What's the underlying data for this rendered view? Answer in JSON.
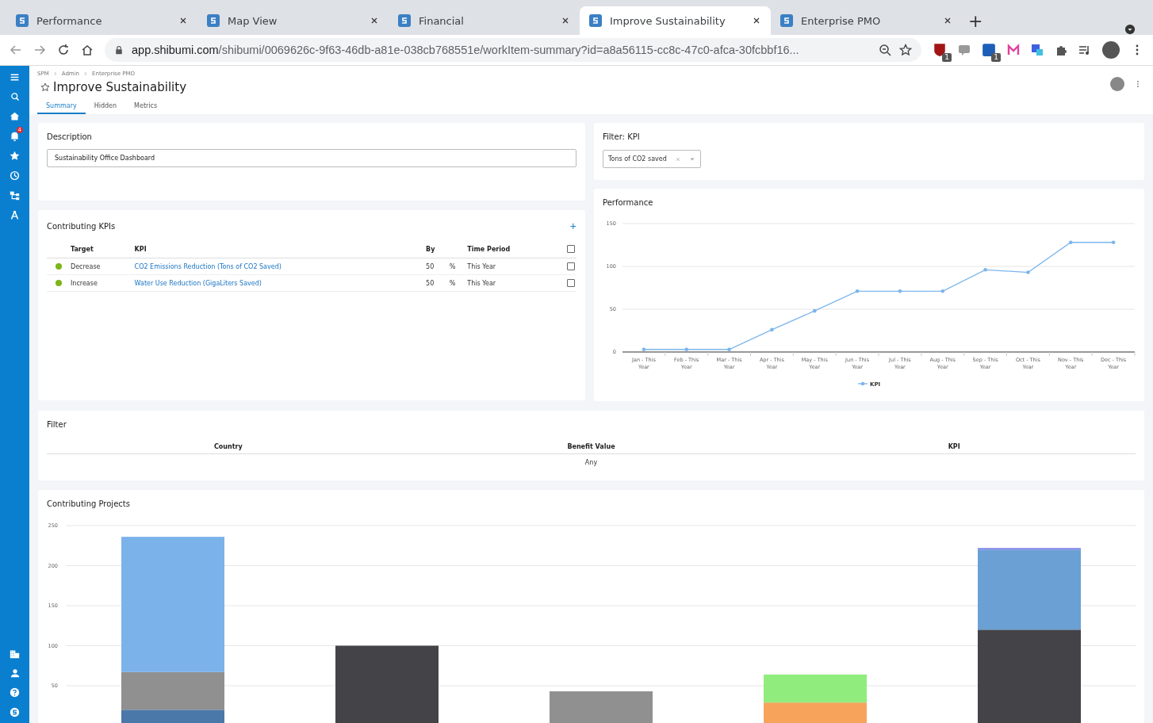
{
  "browser": {
    "tabs": [
      {
        "title": "Performance",
        "selected": false
      },
      {
        "title": "Map View",
        "selected": false
      },
      {
        "title": "Financial",
        "selected": false
      },
      {
        "title": "Improve Sustainability",
        "selected": true
      },
      {
        "title": "Enterprise PMO",
        "selected": false
      }
    ],
    "new_tab": "+",
    "url_host": "app.shibumi.com",
    "url_path": "/shibumi/0069626c-9f63-46db-a81e-038cb768551e/workItem-summary?id=a8a56115-cc8c-47c0-afca-30fcbbf16...",
    "extension_badges": [
      "1",
      "1"
    ]
  },
  "sidebar": {
    "notification_count": "4"
  },
  "header": {
    "breadcrumb": [
      "SPM",
      "Admin",
      "Enterprise PMO"
    ],
    "title": "Improve Sustainability",
    "favorite": false,
    "tabs": [
      {
        "label": "Summary",
        "selected": true
      },
      {
        "label": "Hidden",
        "selected": false
      },
      {
        "label": "Metrics",
        "selected": false
      }
    ]
  },
  "description": {
    "title": "Description",
    "value": "Sustainability Office Dashboard"
  },
  "filter_kpi": {
    "title": "Filter: KPI",
    "value": "Tons of CO2 saved"
  },
  "kpis": {
    "title": "Contributing KPIs",
    "add": "+",
    "columns": {
      "target": "Target",
      "kpi": "KPI",
      "by": "By",
      "time_period": "Time Period"
    },
    "all_checked": false,
    "rows": [
      {
        "color": "#7cb518",
        "target": "Decrease",
        "kpi": "CO2 Emissions Reduction (Tons of CO2 Saved)",
        "by": "50",
        "unit": "%",
        "time_period": "This Year",
        "checked": false
      },
      {
        "color": "#7cb518",
        "target": "Increase",
        "kpi": "Water Use Reduction (GigaLiters Saved)",
        "by": "50",
        "unit": "%",
        "time_period": "This Year",
        "checked": false
      }
    ]
  },
  "performance": {
    "title": "Performance",
    "chart_data": {
      "type": "line",
      "categories": [
        "Jan - This Year",
        "Feb - This Year",
        "Mar - This Year",
        "Apr - This Year",
        "May - This Year",
        "Jun - This Year",
        "Jul - This Year",
        "Aug - This Year",
        "Sep - This Year",
        "Oct - This Year",
        "Nov - This Year",
        "Dec - This Year"
      ],
      "series": [
        {
          "name": "KPI",
          "color": "#7cb5ec",
          "values": [
            3,
            3,
            3,
            26,
            48,
            71,
            71,
            71,
            96,
            93,
            128,
            128
          ]
        }
      ],
      "ylim": [
        0,
        150
      ],
      "yticks": [
        0,
        50,
        100,
        150
      ]
    }
  },
  "filter": {
    "title": "Filter",
    "columns": [
      {
        "label": "Country"
      },
      {
        "label": "Benefit Value",
        "value": "Any"
      },
      {
        "label": "KPI"
      }
    ]
  },
  "projects": {
    "title": "Contributing Projects",
    "chart_data": {
      "type": "bar",
      "stacked": true,
      "series": [
        {
          "color": "#4a78a8",
          "values": [
            20,
            0,
            0,
            0,
            0
          ]
        },
        {
          "color": "#909090",
          "values": [
            47,
            0,
            43,
            0,
            0
          ]
        },
        {
          "color": "#7cb2ea",
          "values": [
            169,
            0,
            0,
            0,
            0
          ]
        },
        {
          "color": "#434348",
          "values": [
            0,
            100,
            0,
            0,
            120
          ]
        },
        {
          "color": "#f7a35c",
          "values": [
            0,
            0,
            0,
            29,
            0
          ]
        },
        {
          "color": "#90ed7d",
          "values": [
            0,
            0,
            0,
            35,
            0
          ]
        },
        {
          "color": "#6ba0d4",
          "values": [
            0,
            0,
            0,
            0,
            100
          ]
        },
        {
          "color": "#8085e9",
          "values": [
            0,
            0,
            0,
            0,
            2
          ]
        }
      ],
      "ylim": [
        0,
        250
      ],
      "yticks": [
        50,
        100,
        150,
        200,
        250
      ],
      "grid": true
    }
  }
}
